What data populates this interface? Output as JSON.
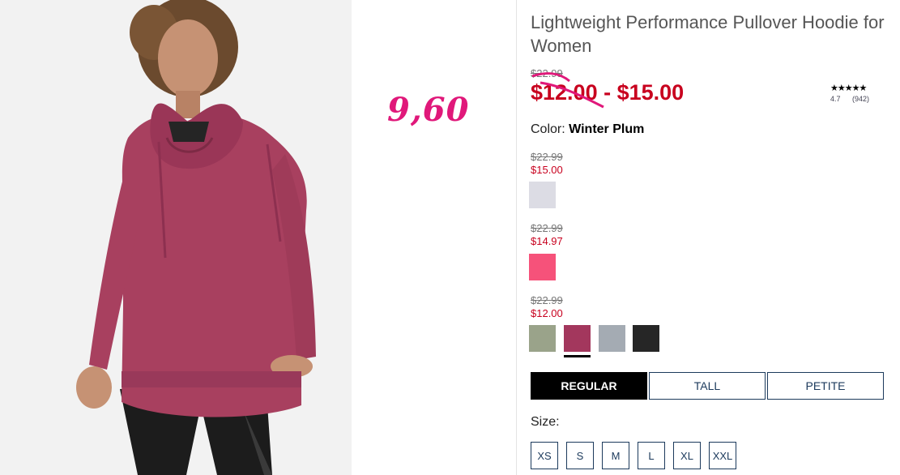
{
  "annotation": "9,60",
  "product": {
    "title": "Lightweight Performance Pullover Hoodie for Women",
    "original_price": "$22.99",
    "price_range": "$12.00 - $15.00",
    "rating": {
      "stars": "★★★★★",
      "score": "4.7",
      "count": "(942)"
    },
    "color_label": "Color:",
    "color_value": "Winter Plum"
  },
  "price_groups": [
    {
      "original": "$22.99",
      "sale": "$15.00",
      "swatches": [
        {
          "name": "white",
          "color": "#dcdce4"
        }
      ]
    },
    {
      "original": "$22.99",
      "sale": "$14.97",
      "swatches": [
        {
          "name": "pink",
          "color": "#f6527a"
        }
      ]
    },
    {
      "original": "$22.99",
      "sale": "$12.00",
      "swatches": [
        {
          "name": "sage",
          "color": "#9aa38a"
        },
        {
          "name": "winter-plum",
          "color": "#a3375d",
          "selected": true
        },
        {
          "name": "heather-gray",
          "color": "#a4abb3"
        },
        {
          "name": "black",
          "color": "#262626"
        }
      ]
    }
  ],
  "fit_tabs": [
    "REGULAR",
    "TALL",
    "PETITE"
  ],
  "size_label": "Size:",
  "sizes": [
    "XS",
    "S",
    "M",
    "L",
    "XL",
    "XXL"
  ]
}
